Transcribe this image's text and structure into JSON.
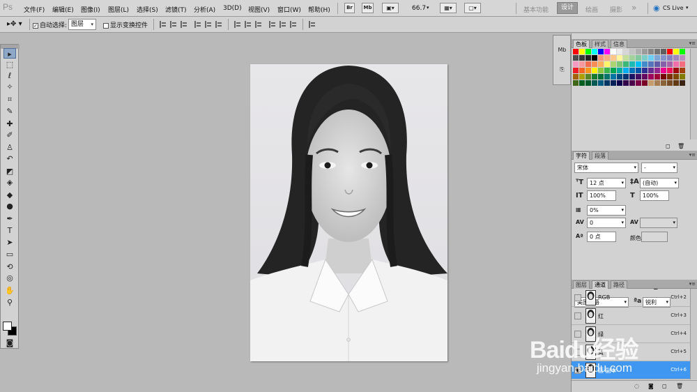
{
  "app": {
    "logo": "Ps"
  },
  "menu": [
    "文件(F)",
    "编辑(E)",
    "图像(I)",
    "图层(L)",
    "选择(S)",
    "滤镜(T)",
    "分析(A)",
    "3D(D)",
    "视图(V)",
    "窗口(W)",
    "帮助(H)"
  ],
  "menubar": {
    "bridge_label": "Br",
    "minibridge_label": "Mb",
    "zoom": "66.7",
    "workspaces": [
      "基本功能",
      "设计",
      "绘画",
      "摄影"
    ],
    "active_workspace": "设计",
    "more": "»",
    "cslive": "CS Live"
  },
  "options": {
    "auto_select_label": "自动选择:",
    "auto_select_checked": true,
    "auto_select_target": "图层",
    "show_transform_label": "显示变换控件",
    "show_transform_checked": false
  },
  "toolbox": {
    "tools": [
      {
        "name": "move-tool",
        "glyph": "▸"
      },
      {
        "name": "marquee-tool",
        "glyph": "⬚"
      },
      {
        "name": "lasso-tool",
        "glyph": "ℓ"
      },
      {
        "name": "quick-select-tool",
        "glyph": "✧"
      },
      {
        "name": "crop-tool",
        "glyph": "⌗"
      },
      {
        "name": "eyedropper-tool",
        "glyph": "✎"
      },
      {
        "name": "healing-brush-tool",
        "glyph": "✚"
      },
      {
        "name": "brush-tool",
        "glyph": "✐"
      },
      {
        "name": "clone-stamp-tool",
        "glyph": "♙"
      },
      {
        "name": "history-brush-tool",
        "glyph": "↶"
      },
      {
        "name": "eraser-tool",
        "glyph": "◩"
      },
      {
        "name": "paint-bucket-tool",
        "glyph": "◈"
      },
      {
        "name": "blur-tool",
        "glyph": "◆"
      },
      {
        "name": "dodge-tool",
        "glyph": "●"
      },
      {
        "name": "pen-tool",
        "glyph": "✒"
      },
      {
        "name": "type-tool",
        "glyph": "T"
      },
      {
        "name": "path-select-tool",
        "glyph": "➤"
      },
      {
        "name": "rectangle-tool",
        "glyph": "▭"
      },
      {
        "name": "3d-rotate-tool",
        "glyph": "⟲"
      },
      {
        "name": "3d-orbit-tool",
        "glyph": "◎"
      },
      {
        "name": "hand-tool",
        "glyph": "✋"
      },
      {
        "name": "zoom-tool",
        "glyph": "⚲"
      }
    ],
    "quick_mask": "◙"
  },
  "icon_strip": [
    {
      "name": "minibridge-icon",
      "label": "Mb"
    },
    {
      "name": "history-icon",
      "label": "⎘"
    }
  ],
  "swatches_panel": {
    "tabs": [
      "色板",
      "样式",
      "信息"
    ],
    "active_tab": "色板",
    "colors": [
      "#ff0000",
      "#ffff00",
      "#00ff00",
      "#00ffff",
      "#0000ff",
      "#ff00ff",
      "#ffffff",
      "#ebebeb",
      "#d7d7d7",
      "#c3c3c3",
      "#afafaf",
      "#9b9b9b",
      "#878787",
      "#737373",
      "#5f5f5f",
      "#ff0000",
      "#ffff00",
      "#00ff00",
      "#4b4b4b",
      "#373737",
      "#232323",
      "#000000",
      "#f7977a",
      "#f9ad81",
      "#fdc68a",
      "#fff79a",
      "#c4df9b",
      "#a3d39c",
      "#82ca9d",
      "#7bcdc8",
      "#6ecff6",
      "#7ea7d8",
      "#8493ca",
      "#8882be",
      "#a187be",
      "#bc8dbf",
      "#f49ac2",
      "#f6989d",
      "#f26c4f",
      "#f68e55",
      "#fbaf5c",
      "#fff467",
      "#acd372",
      "#7cc576",
      "#3bb878",
      "#1abbb4",
      "#00bff3",
      "#438ccb",
      "#5574b9",
      "#605ca8",
      "#855fa8",
      "#a763a8",
      "#f06ea9",
      "#f26d7d",
      "#ed1c24",
      "#f26522",
      "#f7941d",
      "#fff200",
      "#8dc73f",
      "#39b54a",
      "#00a651",
      "#00a99d",
      "#00aeef",
      "#0072bc",
      "#0054a6",
      "#2e3192",
      "#662d91",
      "#92278f",
      "#ec008c",
      "#ed145b",
      "#9e0b0f",
      "#a0410d",
      "#a36209",
      "#aba000",
      "#598527",
      "#1a7b30",
      "#007236",
      "#00746b",
      "#0076a3",
      "#004b80",
      "#003471",
      "#1b1464",
      "#440e62",
      "#630460",
      "#9e005d",
      "#9e0039",
      "#790000",
      "#7b2e00",
      "#7d4900",
      "#827b00",
      "#406618",
      "#005e20",
      "#005826",
      "#005952",
      "#005b7f",
      "#003663",
      "#002157",
      "#0d004c",
      "#32004b",
      "#4b0049",
      "#7b0046",
      "#7a0026",
      "#c69c6d",
      "#a67c52",
      "#8c6239",
      "#754c24",
      "#603913",
      "#3c2415"
    ],
    "menu_icon": "▾≡"
  },
  "character_panel": {
    "tabs": [
      "字符",
      "段落"
    ],
    "active_tab": "字符",
    "font_family": "宋体",
    "font_style": "-",
    "size": "12 点",
    "leading": "(自动)",
    "vscale": "100%",
    "hscale": "100%",
    "tsume": "0%",
    "kerning": "0",
    "tracking": "",
    "baseline": "0 点",
    "color_label": "颜色:",
    "style_buttons": [
      "T",
      "T",
      "TT",
      "Tr",
      "T¹",
      "T,",
      "T",
      "Ŧ"
    ],
    "language": "美国英语",
    "aa_label": "ªa",
    "antialias": "锐利"
  },
  "channels_panel": {
    "tabs": [
      "图层",
      "通道",
      "路径"
    ],
    "active_tab": "通道",
    "rows": [
      {
        "name": "RGB",
        "shortcut": "Ctrl+2",
        "active": false,
        "visible": false
      },
      {
        "name": "红",
        "shortcut": "Ctrl+3",
        "active": false,
        "visible": false
      },
      {
        "name": "绿",
        "shortcut": "Ctrl+4",
        "active": false,
        "visible": false
      },
      {
        "name": "蓝",
        "shortcut": "Ctrl+5",
        "active": false,
        "visible": false
      },
      {
        "name": "蓝 副本",
        "shortcut": "Ctrl+6",
        "active": true,
        "visible": true
      }
    ]
  },
  "watermark": {
    "brand": "Baidu经验",
    "url": "jingyan.baidu.com"
  }
}
